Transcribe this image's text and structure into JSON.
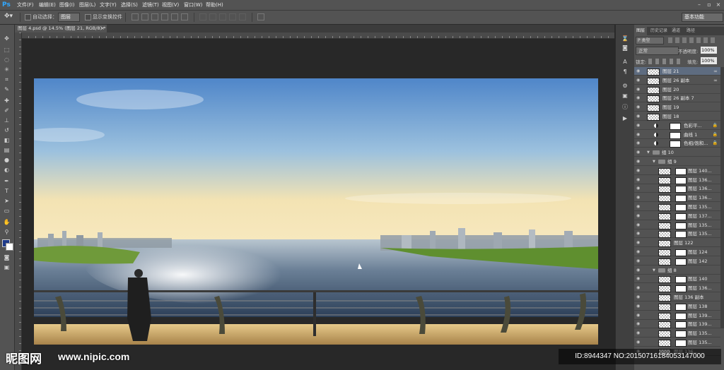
{
  "app": {
    "logo": "Ps"
  },
  "menu": [
    "文件(F)",
    "编辑(E)",
    "图像(I)",
    "图层(L)",
    "文字(Y)",
    "选择(S)",
    "滤镜(T)",
    "视图(V)",
    "窗口(W)",
    "帮助(H)"
  ],
  "options": {
    "auto_select_label": "自动选择：",
    "auto_select_value": "图层",
    "show_transform_label": "显示变换控件",
    "workspace": "基本功能"
  },
  "document": {
    "tab_title": "图层 4.psd @ 14.5% (图层 21, RGB/8) *",
    "tab_close": "×"
  },
  "layers_panel": {
    "tabs": [
      "图层",
      "历史记录",
      "通道",
      "路径"
    ],
    "kind_label": "P 类型",
    "blend_mode": "正常",
    "opacity_label": "不透明度:",
    "opacity_value": "100%",
    "lock_label": "锁定:",
    "fill_label": "填充:",
    "fill_value": "100%",
    "layers": [
      {
        "name": "图层 21",
        "selected": true,
        "indent": 0,
        "type": "layer",
        "link": true
      },
      {
        "name": "图层 26 副本",
        "indent": 0,
        "type": "layer",
        "link": true
      },
      {
        "name": "图层 20",
        "indent": 0,
        "type": "layer"
      },
      {
        "name": "图层 26 副本 7",
        "indent": 0,
        "type": "layer"
      },
      {
        "name": "图层 19",
        "indent": 0,
        "type": "layer"
      },
      {
        "name": "图层 18",
        "indent": 0,
        "type": "layer"
      },
      {
        "name": "色彩平...",
        "indent": 0,
        "type": "adjust",
        "lock": true
      },
      {
        "name": "曲线 1",
        "indent": 0,
        "type": "adjust",
        "lock": true
      },
      {
        "name": "色相/饱和...",
        "indent": 0,
        "type": "adjust",
        "lock": true
      },
      {
        "name": "组 10",
        "indent": 0,
        "type": "group"
      },
      {
        "name": "组 9",
        "indent": 1,
        "type": "group"
      },
      {
        "name": "图层 140...",
        "indent": 2,
        "type": "masked"
      },
      {
        "name": "图层 136...",
        "indent": 2,
        "type": "masked"
      },
      {
        "name": "图层 136...",
        "indent": 2,
        "type": "masked"
      },
      {
        "name": "图层 136...",
        "indent": 2,
        "type": "masked"
      },
      {
        "name": "图层 135...",
        "indent": 2,
        "type": "masked"
      },
      {
        "name": "图层 137...",
        "indent": 2,
        "type": "masked"
      },
      {
        "name": "图层 135...",
        "indent": 2,
        "type": "masked"
      },
      {
        "name": "图层 135...",
        "indent": 2,
        "type": "masked"
      },
      {
        "name": "图层 122",
        "indent": 2,
        "type": "layer"
      },
      {
        "name": "图层 124",
        "indent": 2,
        "type": "masked"
      },
      {
        "name": "图层 142",
        "indent": 2,
        "type": "masked"
      },
      {
        "name": "组 8",
        "indent": 1,
        "type": "group"
      },
      {
        "name": "图层 140",
        "indent": 2,
        "type": "masked"
      },
      {
        "name": "图层 136...",
        "indent": 2,
        "type": "masked"
      },
      {
        "name": "图层 136 副本",
        "indent": 2,
        "type": "layer"
      },
      {
        "name": "图层 138",
        "indent": 2,
        "type": "masked"
      },
      {
        "name": "图层 139...",
        "indent": 2,
        "type": "masked"
      },
      {
        "name": "图层 139...",
        "indent": 2,
        "type": "masked"
      },
      {
        "name": "图层 135...",
        "indent": 2,
        "type": "masked"
      },
      {
        "name": "图层 135...",
        "indent": 2,
        "type": "masked"
      },
      {
        "name": "图层 136...",
        "indent": 2,
        "type": "layer"
      }
    ]
  },
  "watermark": {
    "brand": "昵图网",
    "url": "www.nipic.com",
    "id_text": "ID:8944347 NO:20150716184053147000"
  },
  "colors": {
    "accent": "#31a8ff",
    "panel": "#535353",
    "canvas_bg": "#282828"
  }
}
